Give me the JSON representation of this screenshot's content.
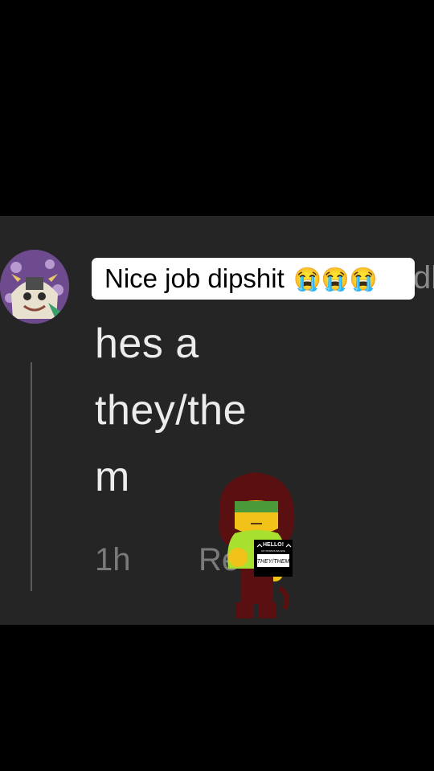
{
  "caption": {
    "text": "Nice job dipshit",
    "emojis": "😭😭😭"
  },
  "comment": {
    "username_fragment": "dl",
    "lines": [
      "hes a",
      "they/the",
      "m"
    ],
    "timestamp": "1h",
    "reply_label": "Reply"
  },
  "sticker": {
    "sign_title": "HELLO!",
    "sign_subtitle": "MY PRONOUNS ARE",
    "sign_text": "THEY/THEM"
  }
}
